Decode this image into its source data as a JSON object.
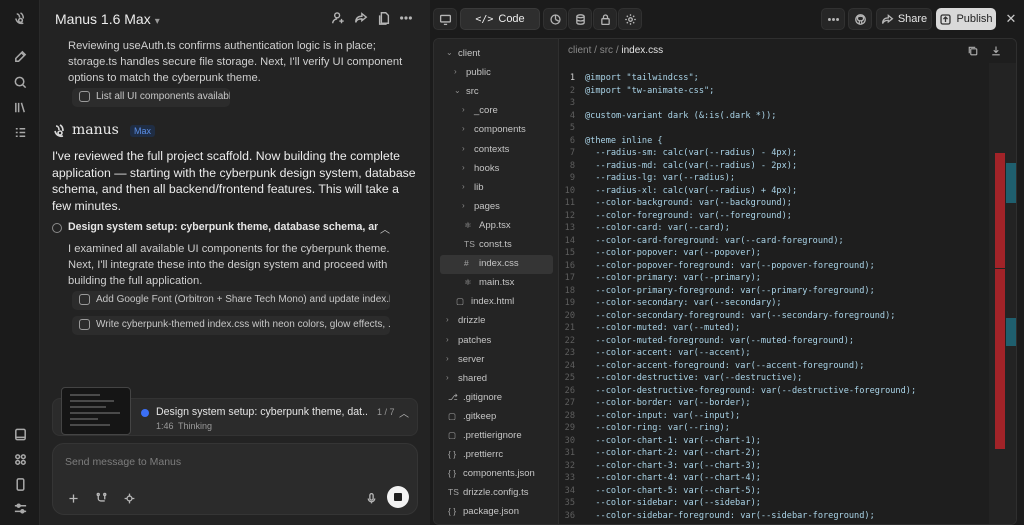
{
  "chat": {
    "title": "Manus 1.6 Max",
    "intro_text": "Reviewing useAuth.ts confirms authentication logic is in place; storage.ts handles secure file storage. Next, I'll verify UI component options to match the cyberpunk theme.",
    "intro_chip": "List all UI components available",
    "agent_name": "manus",
    "agent_badge": "Max",
    "message": "I've reviewed the full project scaffold. Now building the complete application — starting with the cyberpunk design system, database schema, and then all backend/frontend features. This will take a few minutes.",
    "step_title": "Design system setup: cyberpunk theme, database schema, and t...",
    "step_text": "I examined all available UI components for the cyberpunk theme. Next, I'll integrate these into the design system and proceed with building the full application.",
    "step_chips": [
      "Add Google Font (Orbitron + Share Tech Mono) and update index.h...",
      "Write cyberpunk-themed index.css with neon colors, glow effects, ..."
    ],
    "status": {
      "title": "Design system setup: cyberpunk theme, dat...",
      "count": "1 / 7",
      "time": "1:46",
      "state": "Thinking"
    },
    "input_placeholder": "Send message to Manus"
  },
  "toolbar": {
    "code_label": "Code",
    "share_label": "Share",
    "publish_label": "Publish"
  },
  "breadcrumb": [
    "client",
    "src",
    "index.css"
  ],
  "file_tree": [
    {
      "name": "client",
      "type": "folder",
      "open": true,
      "depth": 0
    },
    {
      "name": "public",
      "type": "folder",
      "open": false,
      "depth": 1
    },
    {
      "name": "src",
      "type": "folder",
      "open": true,
      "depth": 1
    },
    {
      "name": "_core",
      "type": "folder",
      "open": false,
      "depth": 2
    },
    {
      "name": "components",
      "type": "folder",
      "open": false,
      "depth": 2
    },
    {
      "name": "contexts",
      "type": "folder",
      "open": false,
      "depth": 2
    },
    {
      "name": "hooks",
      "type": "folder",
      "open": false,
      "depth": 2
    },
    {
      "name": "lib",
      "type": "folder",
      "open": false,
      "depth": 2
    },
    {
      "name": "pages",
      "type": "folder",
      "open": false,
      "depth": 2
    },
    {
      "name": "App.tsx",
      "type": "react",
      "depth": 2
    },
    {
      "name": "const.ts",
      "type": "ts",
      "depth": 2
    },
    {
      "name": "index.css",
      "type": "css",
      "depth": 2,
      "selected": true
    },
    {
      "name": "main.tsx",
      "type": "react",
      "depth": 2
    },
    {
      "name": "index.html",
      "type": "file",
      "depth": 1
    },
    {
      "name": "drizzle",
      "type": "folder",
      "open": false,
      "depth": 0
    },
    {
      "name": "patches",
      "type": "folder",
      "open": false,
      "depth": 0
    },
    {
      "name": "server",
      "type": "folder",
      "open": false,
      "depth": 0
    },
    {
      "name": "shared",
      "type": "folder",
      "open": false,
      "depth": 0
    },
    {
      "name": ".gitignore",
      "type": "git",
      "depth": 0
    },
    {
      "name": ".gitkeep",
      "type": "file",
      "depth": 0
    },
    {
      "name": ".prettierignore",
      "type": "file",
      "depth": 0
    },
    {
      "name": ".prettierrc",
      "type": "json",
      "depth": 0
    },
    {
      "name": "components.json",
      "type": "json",
      "depth": 0
    },
    {
      "name": "drizzle.config.ts",
      "type": "ts",
      "depth": 0
    },
    {
      "name": "package.json",
      "type": "json",
      "depth": 0
    }
  ],
  "code_lines": [
    "@import \"tailwindcss\";",
    "@import \"tw-animate-css\";",
    "",
    "@custom-variant dark (&:is(.dark *));",
    "",
    "@theme inline {",
    "  --radius-sm: calc(var(--radius) - 4px);",
    "  --radius-md: calc(var(--radius) - 2px);",
    "  --radius-lg: var(--radius);",
    "  --radius-xl: calc(var(--radius) + 4px);",
    "  --color-background: var(--background);",
    "  --color-foreground: var(--foreground);",
    "  --color-card: var(--card);",
    "  --color-card-foreground: var(--card-foreground);",
    "  --color-popover: var(--popover);",
    "  --color-popover-foreground: var(--popover-foreground);",
    "  --color-primary: var(--primary);",
    "  --color-primary-foreground: var(--primary-foreground);",
    "  --color-secondary: var(--secondary);",
    "  --color-secondary-foreground: var(--secondary-foreground);",
    "  --color-muted: var(--muted);",
    "  --color-muted-foreground: var(--muted-foreground);",
    "  --color-accent: var(--accent);",
    "  --color-accent-foreground: var(--accent-foreground);",
    "  --color-destructive: var(--destructive);",
    "  --color-destructive-foreground: var(--destructive-foreground);",
    "  --color-border: var(--border);",
    "  --color-input: var(--input);",
    "  --color-ring: var(--ring);",
    "  --color-chart-1: var(--chart-1);",
    "  --color-chart-2: var(--chart-2);",
    "  --color-chart-3: var(--chart-3);",
    "  --color-chart-4: var(--chart-4);",
    "  --color-chart-5: var(--chart-5);",
    "  --color-sidebar: var(--sidebar);",
    "  --color-sidebar-foreground: var(--sidebar-foreground);"
  ],
  "colors": {
    "accent_blue": "#3b6ff5",
    "code_text": "#aad4e8",
    "minimap_red": "#a12328",
    "minimap_teal": "#1f5f6e"
  }
}
